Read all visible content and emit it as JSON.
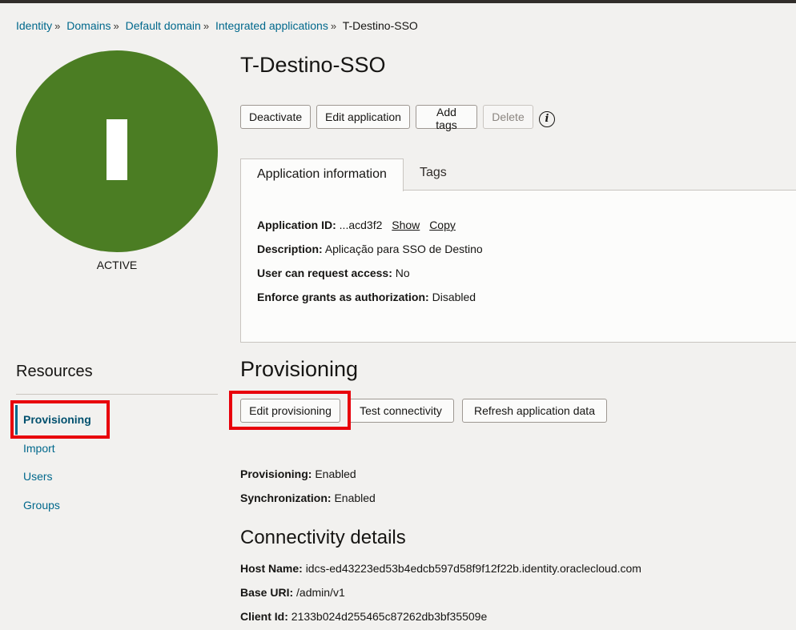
{
  "breadcrumb": {
    "items": [
      "Identity",
      "Domains",
      "Default domain",
      "Integrated applications"
    ],
    "current": "T-Destino-SSO",
    "separator": "»"
  },
  "app": {
    "title": "T-Destino-SSO",
    "badge_letter": "I",
    "status": "ACTIVE",
    "badge_color": "#4b7d23"
  },
  "actions": {
    "deactivate": "Deactivate",
    "edit_application": "Edit application",
    "add_tags": "Add tags",
    "delete": "Delete",
    "info_icon": "i"
  },
  "tabs": {
    "app_info": "Application information",
    "tags": "Tags"
  },
  "app_info": {
    "app_id_label": "Application ID:",
    "app_id_value": "...acd3f2",
    "show": "Show",
    "copy": "Copy",
    "description_label": "Description:",
    "description_value": "Aplicação para SSO de Destino",
    "request_access_label": "User can request access:",
    "request_access_value": "No",
    "enforce_grants_label": "Enforce grants as authorization:",
    "enforce_grants_value": "Disabled"
  },
  "resources": {
    "title": "Resources",
    "items": [
      "Provisioning",
      "Import",
      "Users",
      "Groups"
    ],
    "active": "Provisioning"
  },
  "provisioning": {
    "title": "Provisioning",
    "edit_button": "Edit provisioning",
    "test_button": "Test connectivity",
    "refresh_button": "Refresh application data",
    "provisioning_label": "Provisioning:",
    "provisioning_value": "Enabled",
    "sync_label": "Synchronization:",
    "sync_value": "Enabled"
  },
  "connectivity": {
    "title": "Connectivity details",
    "host_label": "Host Name:",
    "host_value": "idcs-ed43223ed53b4edcb597d58f9f12f22b.identity.oraclecloud.com",
    "base_uri_label": "Base URI:",
    "base_uri_value": "/admin/v1",
    "client_id_label": "Client Id:",
    "client_id_value": "2133b024d255465c87262db3bf35509e"
  },
  "colors": {
    "link": "#00688c",
    "highlight": "#e8000b"
  }
}
